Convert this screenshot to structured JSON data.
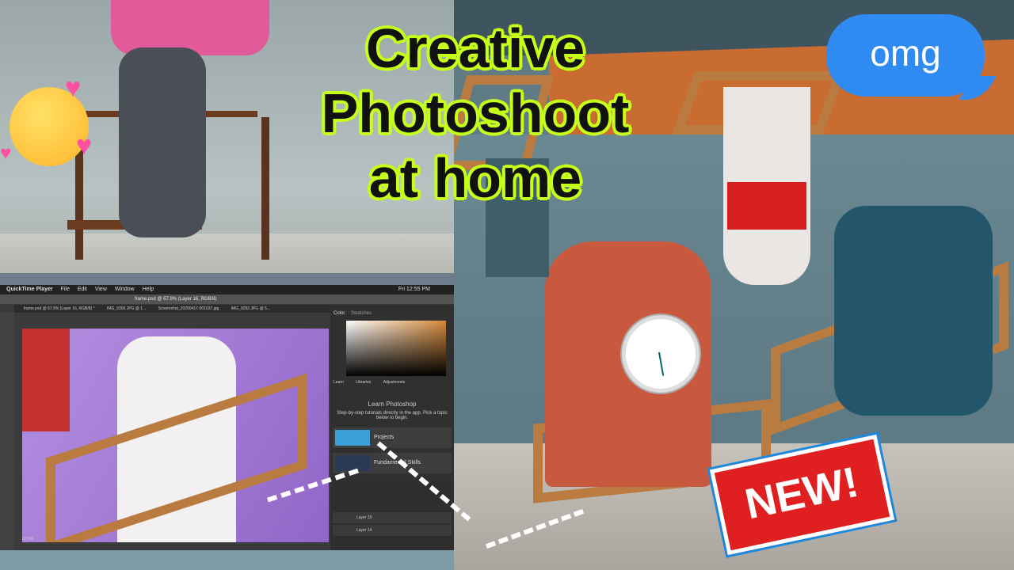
{
  "thumbnail": {
    "title_lines": [
      "Creative",
      "Photoshoot",
      "at home"
    ],
    "bubble_text": "omg",
    "badge_text": "NEW!",
    "colors": {
      "title_outline": "#c6ff1a",
      "bubble": "#2f8bf2",
      "badge": "#e02020",
      "frame": "#b97b3f"
    }
  },
  "photoshop": {
    "menu": [
      "QuickTime Player",
      "File",
      "Edit",
      "View",
      "Window",
      "Help"
    ],
    "clock": "Fri 12:55 PM",
    "window_title": "frame.psd @ 67.9% (Layer 16, RGB/8)",
    "tabs": [
      "frame.psd @ 67.9% (Layer 16, RGB/8) *",
      "IMG_9300.JPG @ 1...",
      "Screenshot_20200417-001037.jpg",
      "IMG_9292.JPG @ 5..."
    ],
    "panel_tabs": [
      "Color",
      "Swatches"
    ],
    "learn_tabs": [
      "Learn",
      "Libraries",
      "Adjustments"
    ],
    "learn_title": "Learn Photoshop",
    "learn_sub": "Step-by-step tutorials directly in the app. Pick a topic below to begin.",
    "learn_items": [
      "Projects",
      "Fundamental Skills"
    ],
    "layers": [
      "Layer 15",
      "Layer 14"
    ],
    "zoom": "67.9%"
  }
}
